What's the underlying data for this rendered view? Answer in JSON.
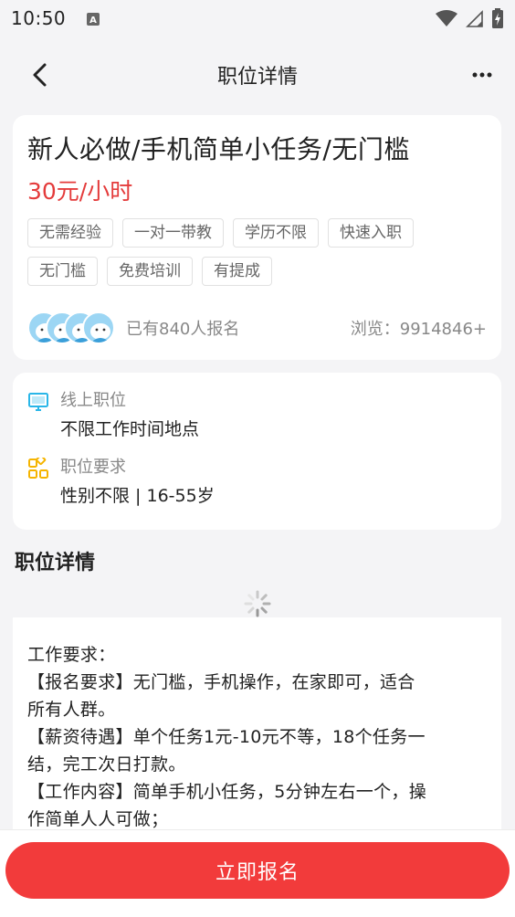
{
  "status_bar": {
    "time": "10:50",
    "icons": [
      "sim-a-icon",
      "wifi-icon",
      "signal-icon",
      "battery-charging-icon"
    ]
  },
  "nav": {
    "title": "职位详情",
    "back_icon": "back-arrow-icon",
    "more_icon": "more-dots-icon"
  },
  "job": {
    "title": "新人必做/手机简单小任务/无门槛",
    "salary": "30元/小时",
    "tags": [
      "无需经验",
      "一对一带教",
      "学历不限",
      "快速入职",
      "无门槛",
      "免费培训",
      "有提成"
    ],
    "signup_count": "已有840人报名",
    "views": "浏览：9914846+"
  },
  "info": {
    "items": [
      {
        "icon": "monitor-icon",
        "label": "线上职位",
        "value": "不限工作时间地点"
      },
      {
        "icon": "grid-apps-icon",
        "label": "职位要求",
        "value": "性别不限 | 16-55岁"
      }
    ]
  },
  "details": {
    "section_title": "职位详情",
    "lines": [
      "工作要求：",
      "【报名要求】无门槛，手机操作，在家即可，适合",
      "所有人群。",
      "【薪资待遇】单个任务1元-10元不等，18个任务一",
      "结，完工次日打款。",
      "【工作内容】简单手机小任务，5分钟左右一个，操",
      "作简单人人可做；"
    ]
  },
  "bottom": {
    "apply_label": "立即报名"
  },
  "colors": {
    "accent": "#f23b3b",
    "salary": "#e43b3b",
    "monitor_icon": "#29b6e8",
    "apps_icon": "#f5b400"
  }
}
